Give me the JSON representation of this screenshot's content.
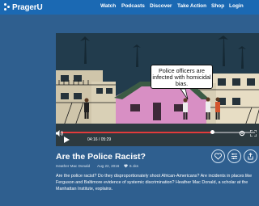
{
  "header": {
    "logo_text": "PragerU",
    "nav": [
      "Watch",
      "Podcasts",
      "Discover",
      "Take Action",
      "Shop",
      "Login"
    ]
  },
  "video": {
    "speech_bubble": "Police officers are infected with homicidal bias.",
    "current_time": "04:16",
    "duration": "05:29",
    "progress": 0.78
  },
  "content": {
    "title": "Are the Police Racist?",
    "author": "Heather Mac Donald",
    "date": "Aug 22, 2016",
    "likes": "6.1ks",
    "description": "Are the police racist? Do they disproportionately shoot African-Americans? Are incidents in places like Ferguson and Baltimore evidence of systemic discrimination? Heather Mac Donald, a scholar at the Manhattan Institute, explains."
  },
  "colors": {
    "nav_bg": "#1b69b3",
    "page_bg": "#2f5f8f",
    "progress": "#e23b3b"
  },
  "icons": [
    "heart-icon",
    "sliders-icon",
    "share-icon",
    "play-icon",
    "volume-icon",
    "settings-icon",
    "fullscreen-icon"
  ]
}
